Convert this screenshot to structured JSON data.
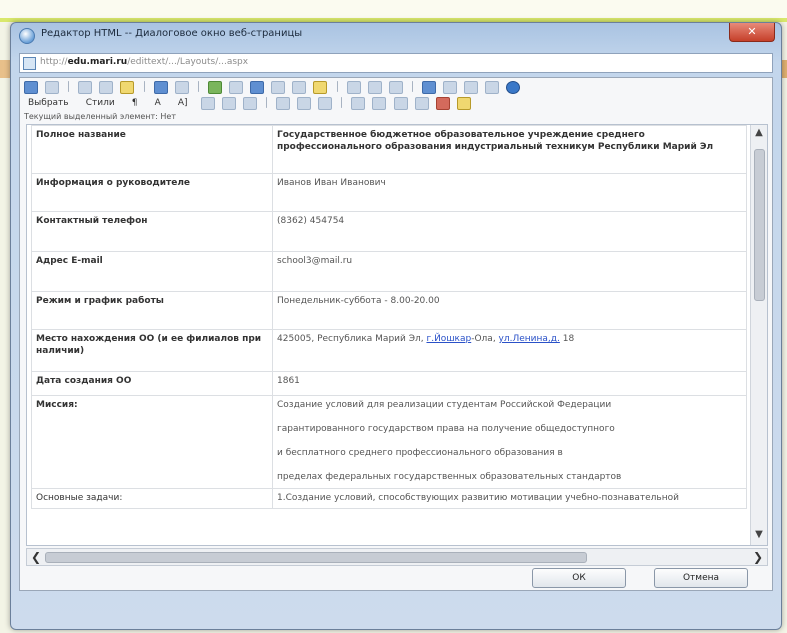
{
  "window": {
    "title": "Редактор HTML -- Диалоговое окно веб-страницы",
    "close_label": "✕"
  },
  "address": {
    "url_prefix": "http://",
    "url_host": "edu.mari.ru",
    "url_rest": "/edittext/.../Layouts/...aspx"
  },
  "toolbar": {
    "select_label": "Выбрать",
    "styles_label": "Стили",
    "paragraph_label": "¶",
    "font_label": "A",
    "fontsize_label": "A]",
    "current_element_text": "Текущий выделенный элемент: Нет"
  },
  "table": {
    "rows": [
      {
        "label": "Полное название",
        "value": "Государственное бюджетное образовательное учреждение среднего профессионального образования индустриальный техникум Республики Марий Эл"
      },
      {
        "label": "Информация о руководителе",
        "value": "Иванов Иван Иванович"
      },
      {
        "label": "Контактный телефон",
        "value": "(8362) 454754"
      },
      {
        "label": "Адрес E-mail",
        "value": "school3@mail.ru"
      },
      {
        "label": "Режим и график работы",
        "value": "Понедельник-суббота - 8.00-20.00"
      },
      {
        "label": "Место нахождения ОО (и ее филиалов при наличии)",
        "value_prefix": "425005, Республика Марий Эл, ",
        "city": "г.Йошкар",
        "value_mid": "-Ола, ",
        "street": "ул.Ленина,д.",
        "value_suffix": " 18"
      },
      {
        "label": "Дата создания ОО",
        "value": "1861"
      },
      {
        "label": "Миссия:",
        "lines": [
          "Создание условий для реализации студентам Российской Федерации",
          "гарантированного государством права на получение общедоступного",
          "и бесплатного среднего профессионального образования в",
          "пределах федеральных государственных образовательных стандартов"
        ]
      },
      {
        "label": "Основные задачи:",
        "value": "1.Создание условий, способствующих развитию мотивации учебно-познавательной"
      }
    ]
  },
  "scroll": {
    "up": "▲",
    "down": "▼",
    "left": "❮",
    "right": "❯"
  },
  "buttons": {
    "ok": "ОК",
    "cancel": "Отмена"
  }
}
